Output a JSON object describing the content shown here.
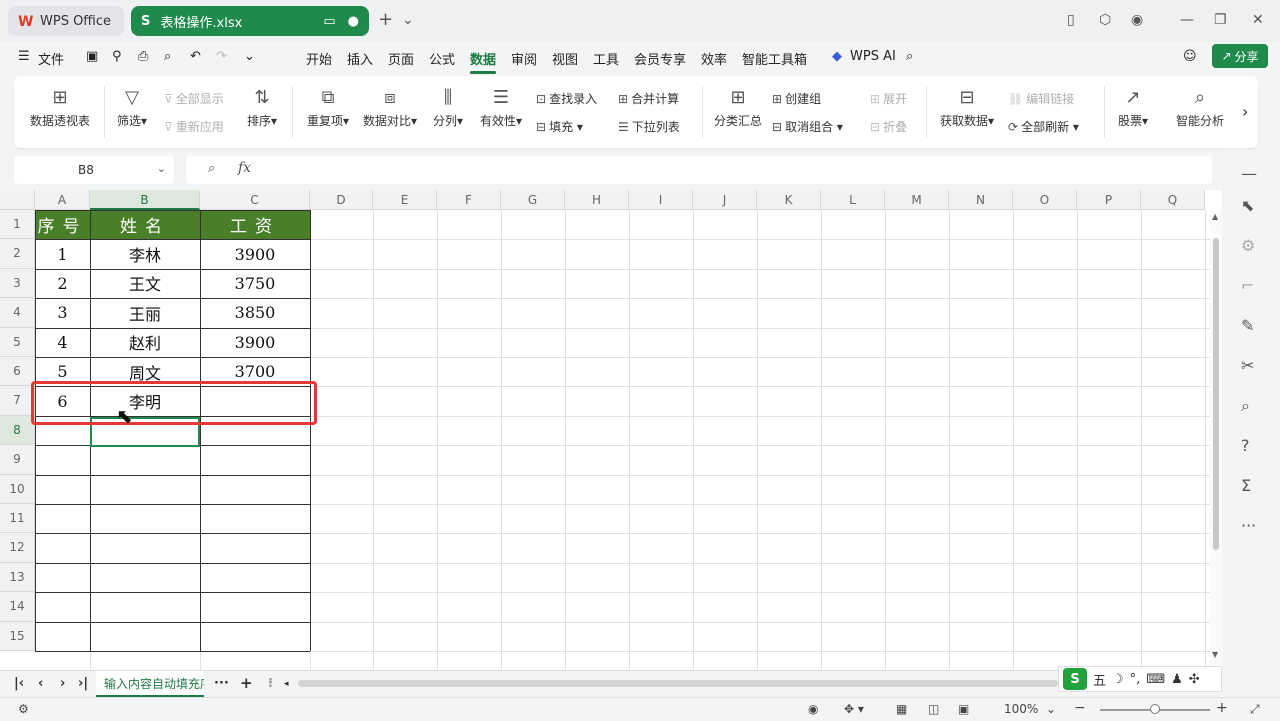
{
  "titlebar": {
    "app_tab": "WPS Office",
    "file_tab": "表格操作.xlsx",
    "file_badge": "S",
    "new_tab": "+"
  },
  "menu": {
    "file": "文件",
    "items": [
      "开始",
      "插入",
      "页面",
      "公式",
      "数据",
      "审阅",
      "视图",
      "工具",
      "会员专享",
      "效率",
      "智能工具箱"
    ],
    "active": "数据",
    "ai": "WPS AI",
    "share": "分享"
  },
  "ribbon": {
    "pivot": "数据透视表",
    "filter": "筛选",
    "show_all": "全部显示",
    "reapply": "重新应用",
    "sort": "排序",
    "duplicates": "重复项",
    "compare": "数据对比",
    "split": "分列",
    "validity": "有效性",
    "lookup_entry": "查找录入",
    "fill": "填充",
    "merge_calc": "合并计算",
    "dropdown_list": "下拉列表",
    "subtotal": "分类汇总",
    "create_group": "创建组",
    "ungroup": "取消组合",
    "expand": "展开",
    "collapse": "折叠",
    "get_data": "获取数据",
    "edit_links": "编辑链接",
    "refresh_all": "全部刷新",
    "stocks": "股票",
    "smart_analysis": "智能分析"
  },
  "formula_bar": {
    "cell_ref": "B8",
    "fx": "fx",
    "content": ""
  },
  "sheet": {
    "columns": [
      "A",
      "B",
      "C",
      "D",
      "E",
      "F",
      "G",
      "H",
      "I",
      "J",
      "K",
      "L",
      "M",
      "N",
      "O",
      "P",
      "Q"
    ],
    "rows": [
      "1",
      "2",
      "3",
      "4",
      "5",
      "6",
      "7",
      "8",
      "9",
      "10",
      "11",
      "12",
      "13",
      "14",
      "15"
    ],
    "headers": [
      "序号",
      "姓名",
      "工资"
    ],
    "data": [
      [
        "1",
        "李林",
        "3900"
      ],
      [
        "2",
        "王文",
        "3750"
      ],
      [
        "3",
        "王丽",
        "3850"
      ],
      [
        "4",
        "赵利",
        "3900"
      ],
      [
        "5",
        "周文",
        "3700"
      ],
      [
        "6",
        "李明",
        ""
      ]
    ],
    "selected_cell": "B8",
    "header_fill": "#4a7f2a",
    "highlight_color": "#e53935"
  },
  "sheet_tabs": {
    "active": "输入内容自动填充序",
    "more": "···",
    "add": "+"
  },
  "ime": {
    "logo": "S",
    "mode": "五"
  },
  "status": {
    "zoom": "100%"
  }
}
